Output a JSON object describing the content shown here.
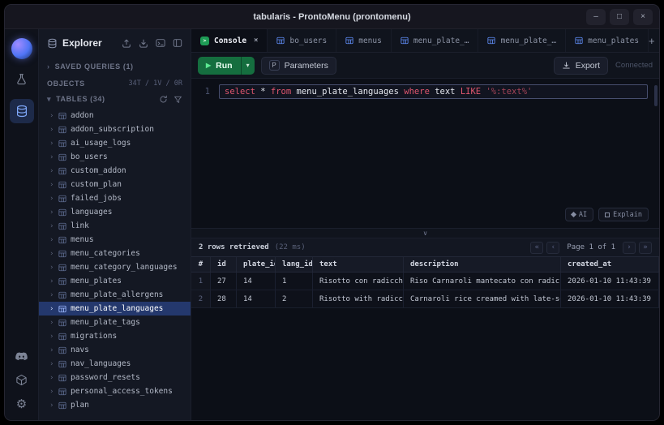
{
  "window": {
    "title": "tabularis - ProntoMenu (prontomenu)"
  },
  "colors": {
    "accent_blue": "#5f8df7",
    "selection_blue": "#24386d",
    "run_green": "#156e3f",
    "keyword_red": "#e0566e",
    "string_red": "#a34457"
  },
  "icons": {
    "minimize": "–",
    "maximize": "□",
    "close": "×",
    "chevron_right": "›",
    "section_caret": "▾",
    "splitter_chevron": "∨",
    "prompt": ">",
    "plus": "+",
    "play": "▶",
    "caret_down": "▾",
    "gear": "⚙",
    "pager_first": "«",
    "pager_prev": "‹",
    "pager_next": "›",
    "pager_last": "»"
  },
  "sidebar": {
    "title": "Explorer",
    "saved_queries": "SAVED QUERIES (1)",
    "objects_label": "OBJECTS",
    "objects_counts": "34T / 1V / 0R",
    "tables_label": "TABLES (34)",
    "selected_table": "menu_plate_languages",
    "tables": [
      "addon",
      "addon_subscription",
      "ai_usage_logs",
      "bo_users",
      "custom_addon",
      "custom_plan",
      "failed_jobs",
      "languages",
      "link",
      "menus",
      "menu_categories",
      "menu_category_languages",
      "menu_plates",
      "menu_plate_allergens",
      "menu_plate_languages",
      "menu_plate_tags",
      "migrations",
      "navs",
      "nav_languages",
      "password_resets",
      "personal_access_tokens",
      "plan"
    ]
  },
  "tabs": [
    {
      "label": "Console",
      "type": "console",
      "active": true
    },
    {
      "label": "bo_users",
      "type": "table",
      "active": false
    },
    {
      "label": "menus",
      "type": "table",
      "active": false
    },
    {
      "label": "menu_plate_…",
      "type": "table",
      "active": false
    },
    {
      "label": "menu_plate_…",
      "type": "table",
      "active": false
    },
    {
      "label": "menu_plates",
      "type": "table",
      "active": false
    }
  ],
  "toolbar": {
    "run_label": "Run",
    "parameters_badge": "P",
    "parameters_label": "Parameters",
    "export_label": "Export",
    "status": "Connected"
  },
  "editor": {
    "line_number": "1",
    "ai_label": "AI",
    "explain_label": "Explain",
    "tokens": [
      {
        "text": "select",
        "type": "kw"
      },
      {
        "text": " * ",
        "type": "plain"
      },
      {
        "text": "from",
        "type": "kw"
      },
      {
        "text": " menu_plate_languages ",
        "type": "id"
      },
      {
        "text": "where",
        "type": "kw"
      },
      {
        "text": " text ",
        "type": "id"
      },
      {
        "text": "LIKE",
        "type": "kw"
      },
      {
        "text": " ",
        "type": "plain"
      },
      {
        "text": "'%:text%'",
        "type": "str"
      }
    ]
  },
  "results": {
    "status": "2 rows retrieved",
    "timing": "(22 ms)",
    "pager_label": "Page 1 of 1",
    "columns": [
      "#",
      "id",
      "plate_id",
      "lang_id",
      "text",
      "description",
      "created_at"
    ],
    "rows": [
      [
        "1",
        "27",
        "14",
        "1",
        "Risotto con radicchio",
        "Riso Carnaroli mantecato con radicc…",
        "2026-01-10 11:43:39"
      ],
      [
        "2",
        "28",
        "14",
        "2",
        "Risotto with radicchio",
        "Carnaroli rice creamed with late-se…",
        "2026-01-10 11:43:39"
      ]
    ]
  }
}
